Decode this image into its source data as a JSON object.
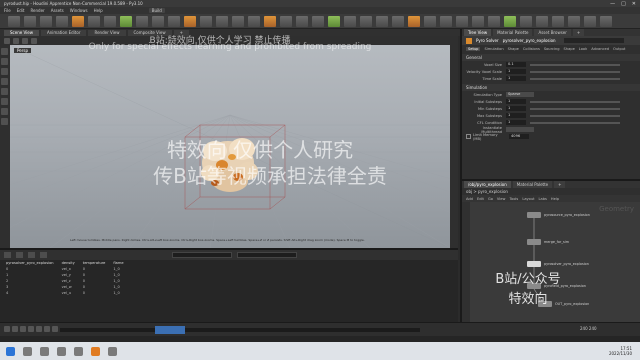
{
  "titlebar": {
    "title": "pyrodust.hip - Houdini Apprentice Non-Commercial 19.0.589 - Py3.10",
    "min": "—",
    "max": "□",
    "close": "✕"
  },
  "menubar": {
    "items": [
      "File",
      "Edit",
      "Render",
      "Assets",
      "Windows",
      "Help"
    ],
    "desktop": "Build"
  },
  "paneltabs": [
    "Scene View",
    "Animation Editor",
    "Render View",
    "Composite View",
    "+"
  ],
  "viewport": {
    "camera_label": "Persp",
    "status": "Left mouse tumbles. Middle pans. Right dollies. Ctrl+Alt+Left box-zooms. Ctrl+Right box-zooms. Space+Left tumbles. Space+Z or Z persists. Shift Alt+Right drag zoom (mode). Space M to toggle."
  },
  "watermarks": {
    "line1": "B站:特效向 仅供个人学习 禁止传播",
    "line2": "Only for special effects learning and prohibited from spreading",
    "line3": "特效向 仅供个人研究",
    "line4": "传B站等视频承担法律全责",
    "line5": "B站/公众号",
    "line6": "特效向"
  },
  "spreadsheet": {
    "node": "pyrosolver_pyro_explosion",
    "headers": [
      "",
      "density",
      "temperature",
      "flame"
    ],
    "rows": [
      [
        "0",
        "vel_x",
        "0",
        "1_0"
      ],
      [
        "1",
        "vel_y",
        "0",
        "1_0"
      ],
      [
        "2",
        "vel_z",
        "0",
        "1_0"
      ],
      [
        "3",
        "vel_w",
        "0",
        "1_0"
      ],
      [
        "4",
        "vel_u",
        "0",
        "1_0"
      ]
    ]
  },
  "timeline": {
    "frame_end": "240",
    "frame_end2": "240"
  },
  "taskbar": {
    "time": "17:51",
    "date": "2022/11/30"
  },
  "params": {
    "tabs": [
      "Tree View",
      "Material Palette",
      "Asset Browser",
      "+"
    ],
    "node_type": "Pyro Solver",
    "node_name": "pyrosolver_pyro_explosion",
    "subtabs": [
      "Setup",
      "Simulation",
      "Shape",
      "Collisions",
      "Sourcing",
      "Shape",
      "Look",
      "Advanced",
      "Output"
    ],
    "section1": "General",
    "fields": [
      {
        "label": "Voxel Size",
        "value": "0.1"
      },
      {
        "label": "Velocity Voxel Scale",
        "value": "1"
      },
      {
        "label": "Time Scale",
        "value": "1"
      }
    ],
    "section2": "Simulation",
    "fields2": [
      {
        "label": "Simulation Type",
        "value": "Sparse"
      },
      {
        "label": "Initial Substeps",
        "value": "1"
      },
      {
        "label": "Min Substeps",
        "value": "1"
      },
      {
        "label": "Max Substeps",
        "value": "1"
      },
      {
        "label": "CFL Condition",
        "value": "1"
      },
      {
        "label": "Instantiate Multithread",
        "value": ""
      }
    ],
    "checkbox_label": "Limit Memory (MB)",
    "checkbox_value": "4096"
  },
  "network": {
    "tabs": [
      "/obj/pyro_explosion",
      "Material Palette",
      "+"
    ],
    "path": "obj > pyro_explosion",
    "toolbar": [
      "Add",
      "Edit",
      "Go",
      "View",
      "Tools",
      "Layout",
      "Labs",
      "Help"
    ],
    "context": "Geometry",
    "nodes": [
      {
        "label": "pyrosource_pyro_explosion"
      },
      {
        "label": "merge_for_sim"
      },
      {
        "label": "pyrosolver_pyro_explosion"
      },
      {
        "label": "pyrofield_pyro_explosion"
      },
      {
        "label": "OUT_pyro_explosion"
      }
    ]
  }
}
